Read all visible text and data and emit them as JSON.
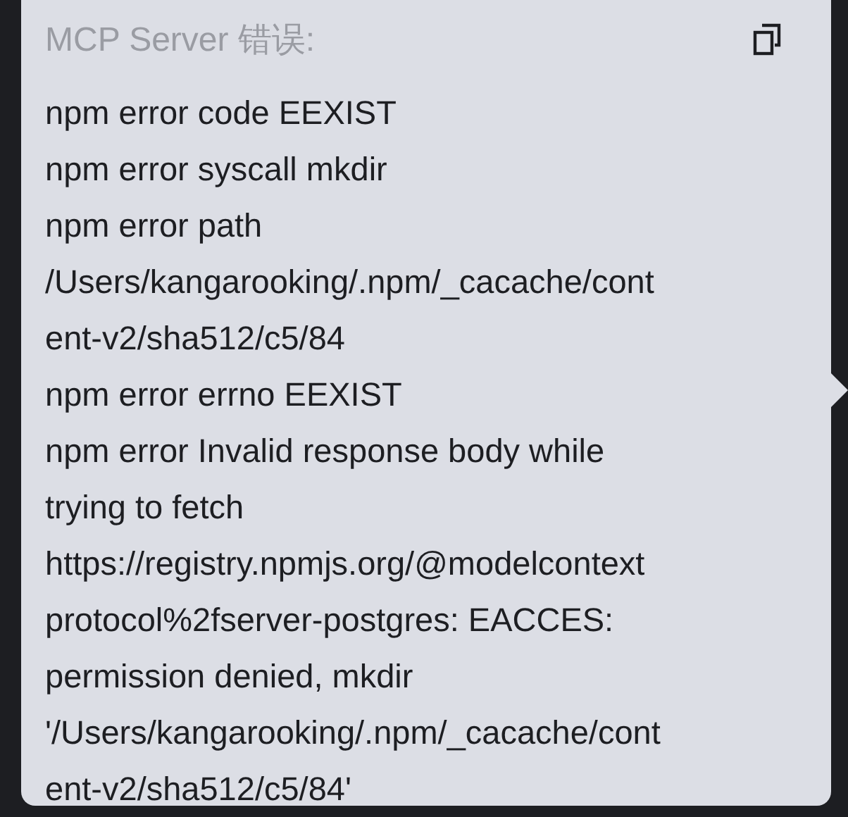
{
  "tooltip": {
    "title": "MCP Server 错误:",
    "lines": [
      "npm error code EEXIST",
      "npm error syscall mkdir",
      "npm error path",
      "/Users/kangarooking/.npm/_cacache/cont",
      "ent-v2/sha512/c5/84",
      "npm error errno EEXIST",
      "npm error Invalid response body while",
      "trying to fetch",
      "https://registry.npmjs.org/@modelcontext",
      "protocol%2fserver-postgres: EACCES:",
      "permission denied, mkdir",
      "'/Users/kangarooking/.npm/_cacache/cont",
      "ent-v2/sha512/c5/84'"
    ]
  }
}
